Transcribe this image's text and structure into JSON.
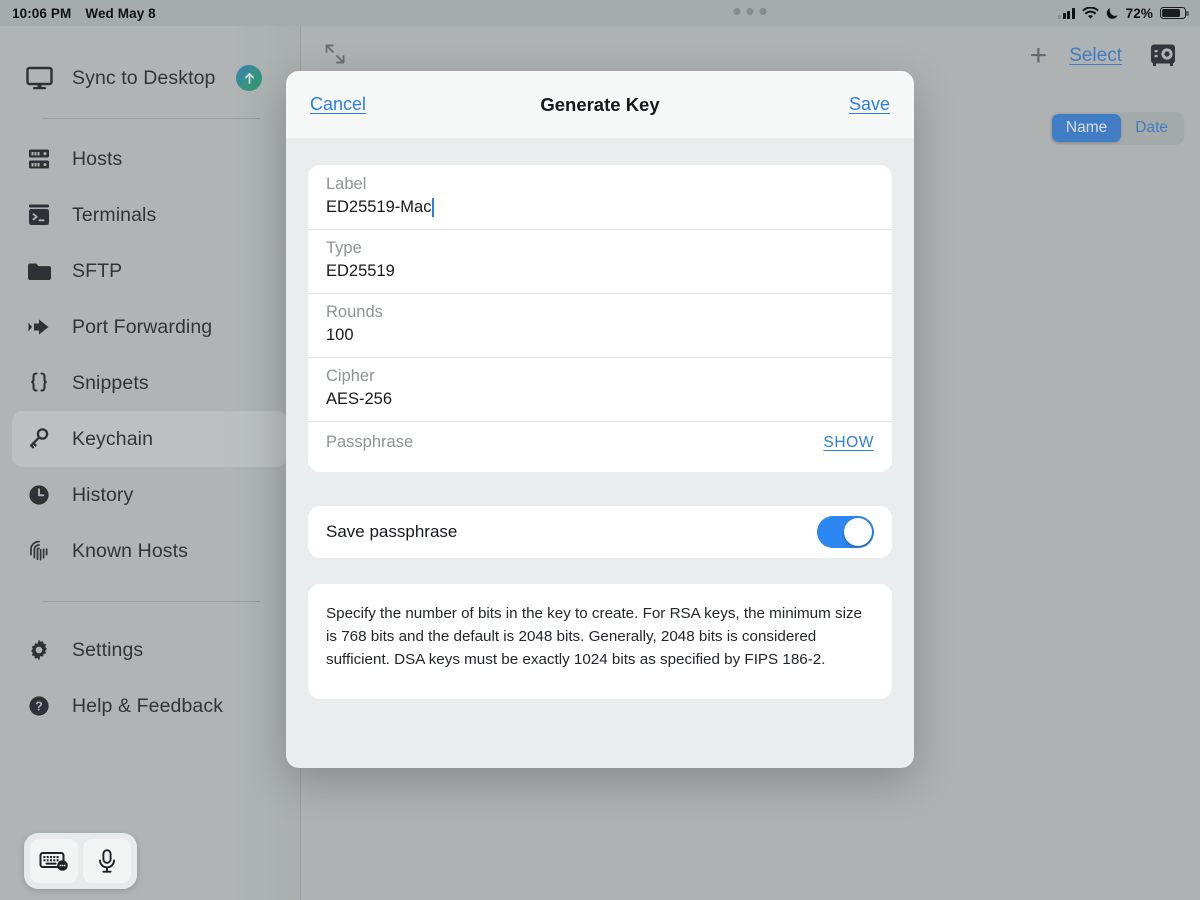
{
  "status_bar": {
    "time": "10:06 PM",
    "date": "Wed May 8",
    "battery_percent": "72%",
    "icons": [
      "cellular-signal-icon",
      "wifi-icon",
      "do-not-disturb-moon-icon",
      "battery-icon"
    ]
  },
  "sidebar": {
    "sync": {
      "label": "Sync to Desktop",
      "icon": "desktop-monitor-icon",
      "badge_icon": "arrow-up-circle-icon"
    },
    "items": [
      {
        "label": "Hosts",
        "icon": "server-rack-icon",
        "selected": false
      },
      {
        "label": "Terminals",
        "icon": "terminal-prompt-icon",
        "selected": false
      },
      {
        "label": "SFTP",
        "icon": "folder-icon",
        "selected": false
      },
      {
        "label": "Port Forwarding",
        "icon": "arrow-forward-icon",
        "selected": false
      },
      {
        "label": "Snippets",
        "icon": "curly-braces-icon",
        "selected": false
      },
      {
        "label": "Keychain",
        "icon": "key-icon",
        "selected": true
      },
      {
        "label": "History",
        "icon": "clock-icon",
        "selected": false
      },
      {
        "label": "Known Hosts",
        "icon": "fingerprint-icon",
        "selected": false
      }
    ],
    "footer_items": [
      {
        "label": "Settings",
        "icon": "gear-icon"
      },
      {
        "label": "Help & Feedback",
        "icon": "question-mark-circle-icon"
      }
    ]
  },
  "toolbar": {
    "resize_icon": "collapse-diagonal-arrows-icon",
    "window_grabber": "three-dots-handle",
    "add_label": "+",
    "select_label": "Select",
    "vault_icon": "safe-vault-icon",
    "segments": [
      {
        "label": "Name",
        "active": true
      },
      {
        "label": "Date",
        "active": false
      }
    ]
  },
  "modal": {
    "cancel_label": "Cancel",
    "title": "Generate Key",
    "save_label": "Save",
    "fields": [
      {
        "label": "Label",
        "value": "ED25519-Mac",
        "focused": true
      },
      {
        "label": "Type",
        "value": "ED25519",
        "focused": false
      },
      {
        "label": "Rounds",
        "value": "100",
        "focused": false
      },
      {
        "label": "Cipher",
        "value": "AES-256",
        "focused": false
      }
    ],
    "passphrase": {
      "label": "Passphrase",
      "action_label": "SHOW"
    },
    "save_passphrase": {
      "label": "Save passphrase",
      "enabled": true
    },
    "note": "Specify the number of bits in the key to create. For RSA keys, the minimum size is 768 bits and the default is 2048 bits. Generally, 2048 bits is considered sufficient. DSA keys must be exactly 1024 bits as specified by FIPS 186-2."
  },
  "dock": {
    "buttons": [
      {
        "icon": "keyboard-icon"
      },
      {
        "icon": "microphone-icon"
      }
    ]
  },
  "colors": {
    "accent_blue": "#2b7de0",
    "toggle_blue": "#2d87f0",
    "sidebar_bg": "#c7cacb",
    "modal_bg": "#e9eded"
  }
}
